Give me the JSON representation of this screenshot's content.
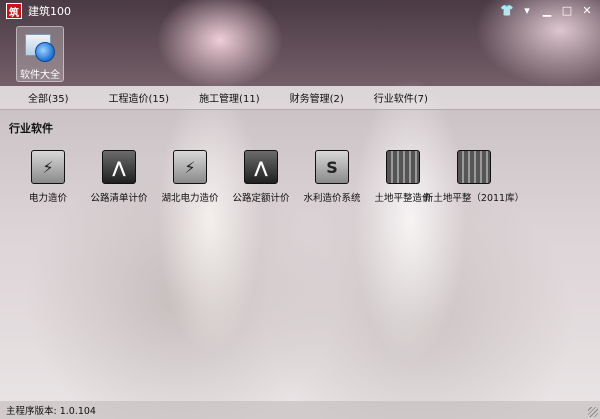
{
  "window": {
    "title": "建筑100",
    "logo_icon": "app-logo-icon",
    "controls": [
      "skin-icon",
      "menu-icon",
      "minimize-icon",
      "maximize-icon",
      "close-icon"
    ]
  },
  "top_tile": {
    "label": "软件大全",
    "icon": "software-box-icon"
  },
  "tabs": [
    {
      "label": "全部(35)"
    },
    {
      "label": "工程造价(15)"
    },
    {
      "label": "施工管理(11)"
    },
    {
      "label": "财务管理(2)"
    },
    {
      "label": "行业软件(7)"
    }
  ],
  "section": {
    "title": "行业软件"
  },
  "apps": [
    {
      "label": "电力造价",
      "icon": "lightning-icon",
      "glyph": "⚡"
    },
    {
      "label": "公路清单计价",
      "icon": "road-icon",
      "glyph": "⋀"
    },
    {
      "label": "湖北电力造价",
      "icon": "lightning-icon",
      "glyph": "⚡"
    },
    {
      "label": "公路定额计价",
      "icon": "road-icon",
      "glyph": "⋀"
    },
    {
      "label": "水利造价系统",
      "icon": "water-conservancy-icon",
      "glyph": "S"
    },
    {
      "label": "土地平整造价",
      "icon": "land-grading-icon",
      "glyph": "▦"
    },
    {
      "label": "新土地平整（2011库）",
      "icon": "land-grading-icon",
      "glyph": "▦"
    }
  ],
  "status": {
    "text": "主程序版本: 1.0.104"
  },
  "colors": {
    "logo_red": "#c3161c",
    "titlebar_text": "#ffffff"
  }
}
